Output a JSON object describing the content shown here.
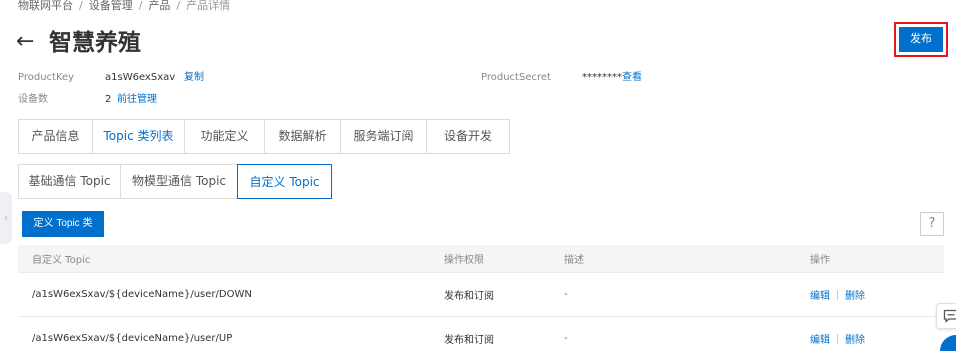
{
  "breadcrumb": {
    "items": [
      "物联网平台",
      "设备管理",
      "产品"
    ],
    "current": "产品详情",
    "separator": "/"
  },
  "header": {
    "back_icon": "←",
    "title": "智慧养殖",
    "publish_label": "发布"
  },
  "meta": {
    "product_key_label": "ProductKey",
    "product_key_value": "a1sW6exSxav",
    "copy_label": "复制",
    "product_secret_label": "ProductSecret",
    "product_secret_value": "********",
    "view_label": "查看",
    "device_count_label": "设备数",
    "device_count_value": "2",
    "manage_label": "前往管理"
  },
  "tabs": [
    {
      "label": "产品信息",
      "active": false
    },
    {
      "label": "Topic 类列表",
      "active": true
    },
    {
      "label": "功能定义",
      "active": false
    },
    {
      "label": "数据解析",
      "active": false
    },
    {
      "label": "服务端订阅",
      "active": false
    },
    {
      "label": "设备开发",
      "active": false
    }
  ],
  "subtabs": [
    {
      "label": "基础通信 Topic",
      "active": false
    },
    {
      "label": "物模型通信 Topic",
      "active": false
    },
    {
      "label": "自定义 Topic",
      "active": true
    }
  ],
  "actions": {
    "define_topic_label": "定义 Topic 类",
    "help_label": "?"
  },
  "table": {
    "columns": [
      "自定义 Topic",
      "操作权限",
      "描述",
      "操作"
    ],
    "rows": [
      {
        "topic": "/a1sW6exSxav/${deviceName}/user/DOWN",
        "permission": "发布和订阅",
        "description": "-",
        "edit": "编辑",
        "delete": "删除"
      },
      {
        "topic": "/a1sW6exSxav/${deviceName}/user/UP",
        "permission": "发布和订阅",
        "description": "-",
        "edit": "编辑",
        "delete": "删除"
      }
    ]
  },
  "colors": {
    "primary": "#0070cc",
    "highlight_border": "#e5161c",
    "header_bg": "#f4f5f7"
  },
  "icons": {
    "back": "arrow-left-icon",
    "side_handle": "chevron-left-icon",
    "feedback": "chat-icon"
  }
}
